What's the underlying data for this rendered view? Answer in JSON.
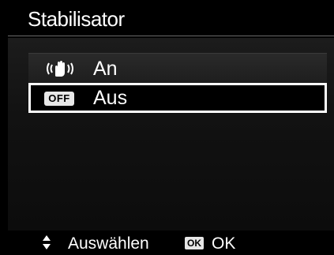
{
  "title": "Stabilisator",
  "options": [
    {
      "icon": "image-stabilizer-hand-icon",
      "label": "An",
      "selected": false
    },
    {
      "icon": "off-badge-icon",
      "badge_text": "OFF",
      "label": "Aus",
      "selected": true
    }
  ],
  "footer": {
    "select_icon": "up-down-arrows-icon",
    "select_label": "Auswählen",
    "ok_badge": "OK",
    "ok_label": "OK"
  }
}
